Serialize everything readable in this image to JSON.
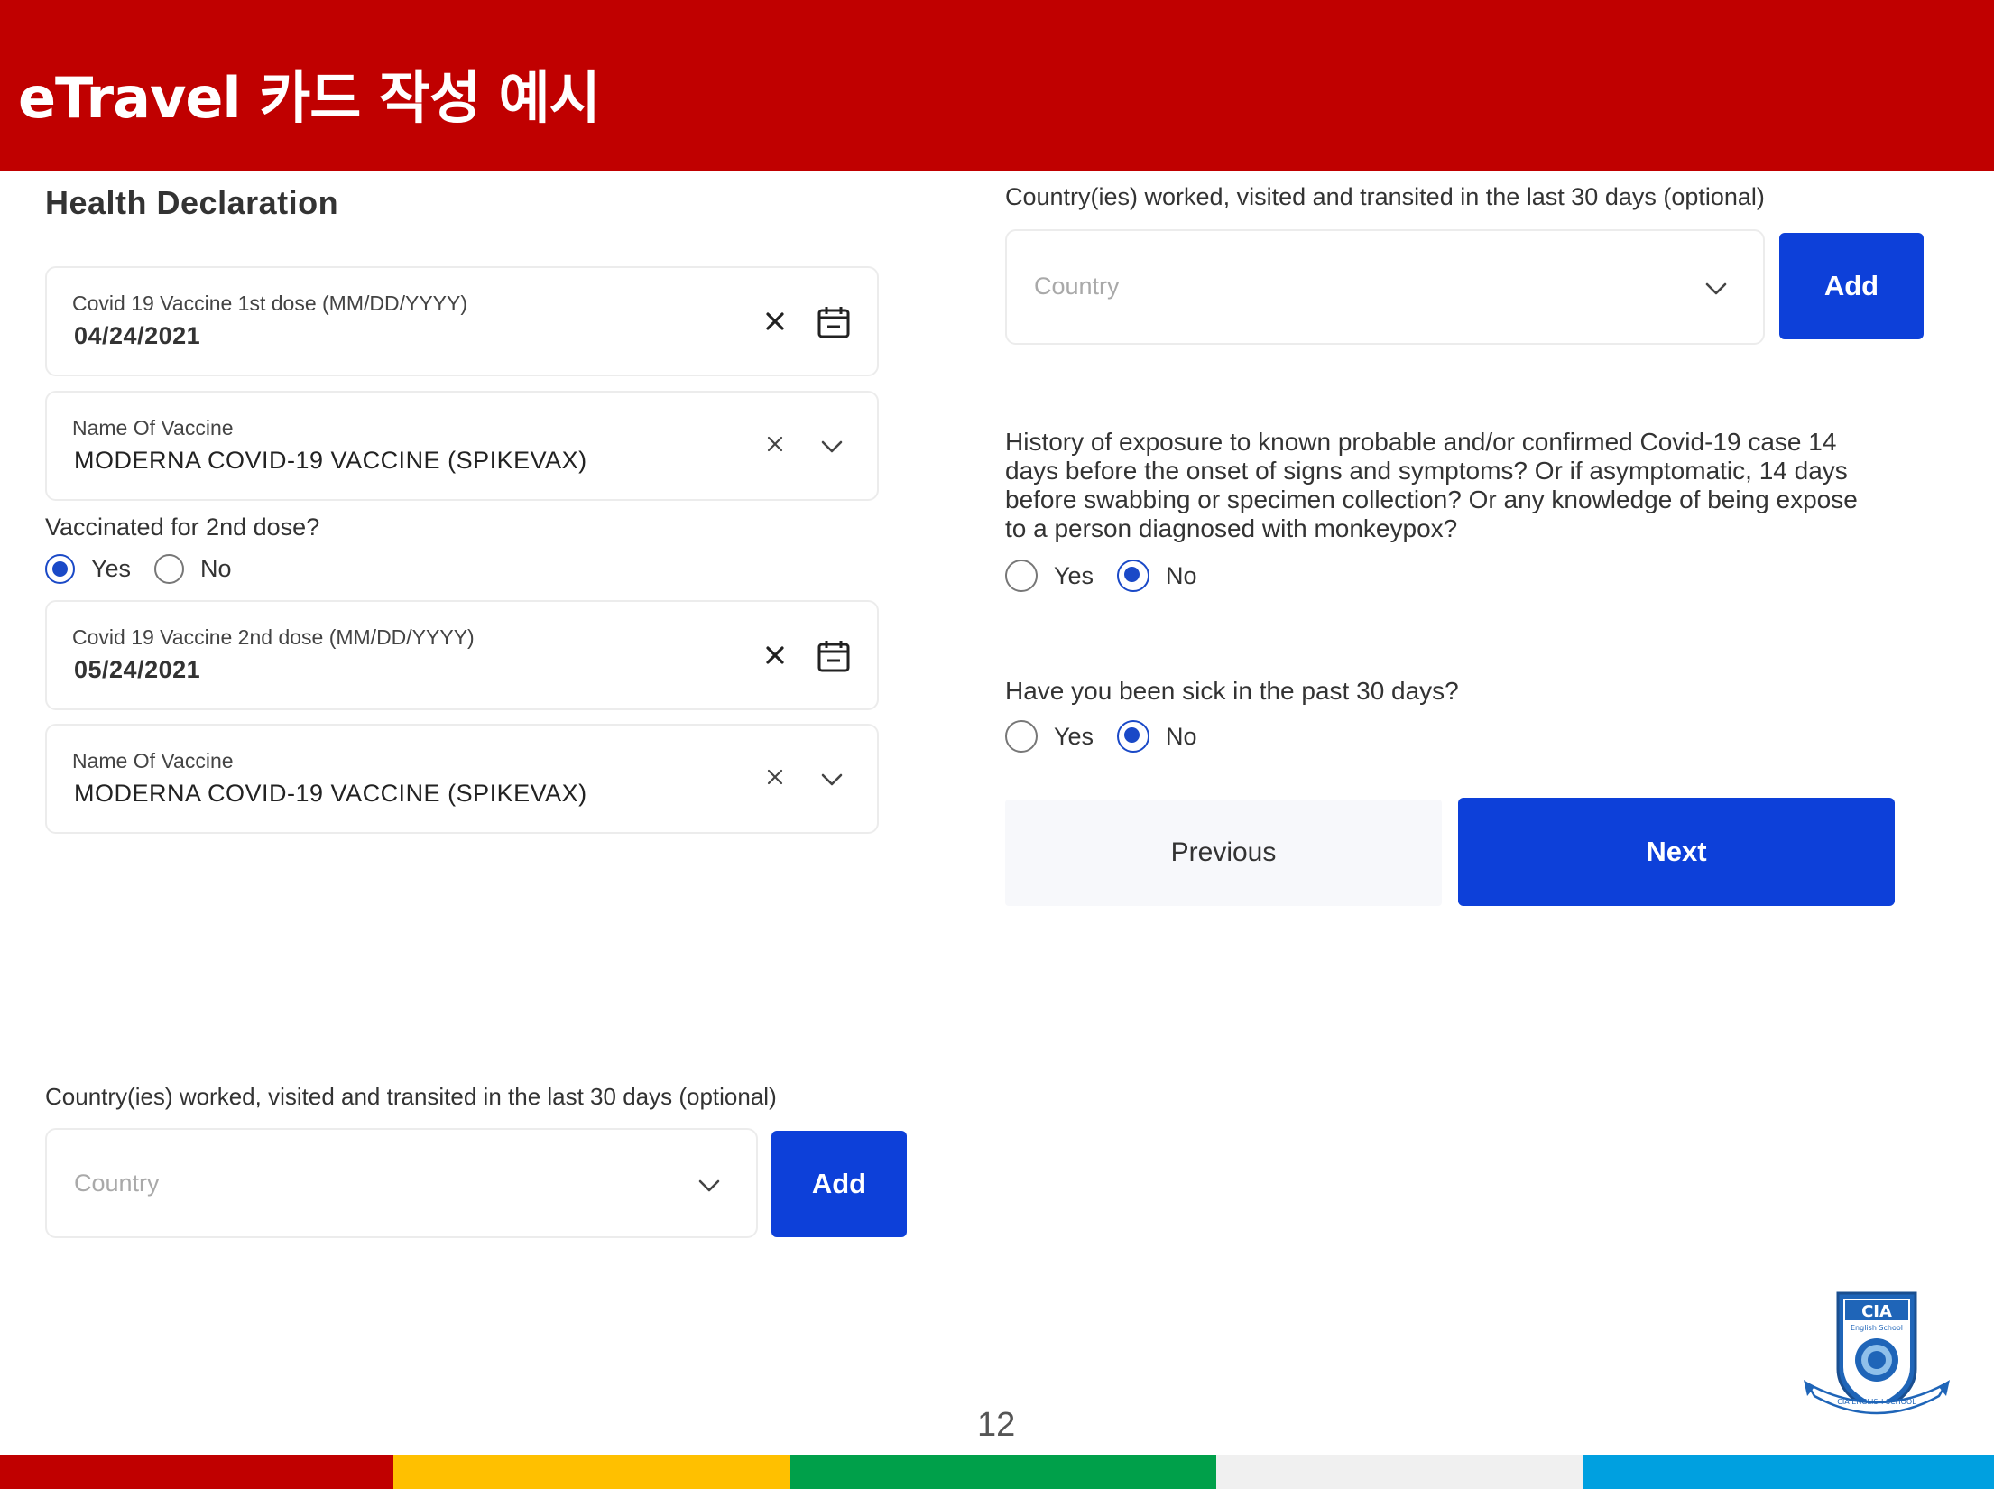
{
  "header": {
    "title": "eTravel 카드 작성 예시"
  },
  "left": {
    "section_title": "Health Declaration",
    "dose1": {
      "label": "Covid 19 Vaccine 1st dose (MM/DD/YYYY)",
      "value": "04/24/2021"
    },
    "vaccine1": {
      "label": "Name Of Vaccine",
      "value": "MODERNA COVID-19 VACCINE (SPIKEVAX)"
    },
    "second_dose": {
      "question": "Vaccinated for 2nd dose?",
      "yes": "Yes",
      "no": "No",
      "selected": "yes"
    },
    "dose2": {
      "label": "Covid 19 Vaccine 2nd dose (MM/DD/YYYY)",
      "value": "05/24/2021"
    },
    "vaccine2": {
      "label": "Name Of Vaccine",
      "value": "MODERNA COVID-19 VACCINE (SPIKEVAX)"
    },
    "countries": {
      "question": "Country(ies) worked, visited and transited in the last 30 days (optional)",
      "placeholder": "Country",
      "add_label": "Add"
    }
  },
  "right": {
    "countries": {
      "question": "Country(ies) worked, visited and transited in the last 30 days (optional)",
      "placeholder": "Country",
      "add_label": "Add"
    },
    "exposure": {
      "question_lines": [
        "History of exposure to known probable and/or confirmed Covid-19 case 14",
        "days before the onset of signs and symptoms? Or if asymptomatic, 14 days",
        "before swabbing or specimen collection? Or any knowledge of being expose",
        "to a person diagnosed with monkeypox?"
      ],
      "yes": "Yes",
      "no": "No",
      "selected": "no"
    },
    "sick": {
      "question": "Have you been sick in the past 30 days?",
      "yes": "Yes",
      "no": "No",
      "selected": "no"
    },
    "previous_label": "Previous",
    "next_label": "Next"
  },
  "page_number": "12",
  "logo": {
    "text": "CIA",
    "subtext": "English School",
    "ribbon_text": "CIA ENGLISH SCHOOL"
  },
  "colors": {
    "header": "#c00000",
    "primary_button": "#0d40d9",
    "radio_selected": "#1a49c7",
    "footer": [
      "#c00000",
      "#ffc000",
      "#00a04a",
      "#f0f0f0",
      "#00a0e0"
    ]
  }
}
